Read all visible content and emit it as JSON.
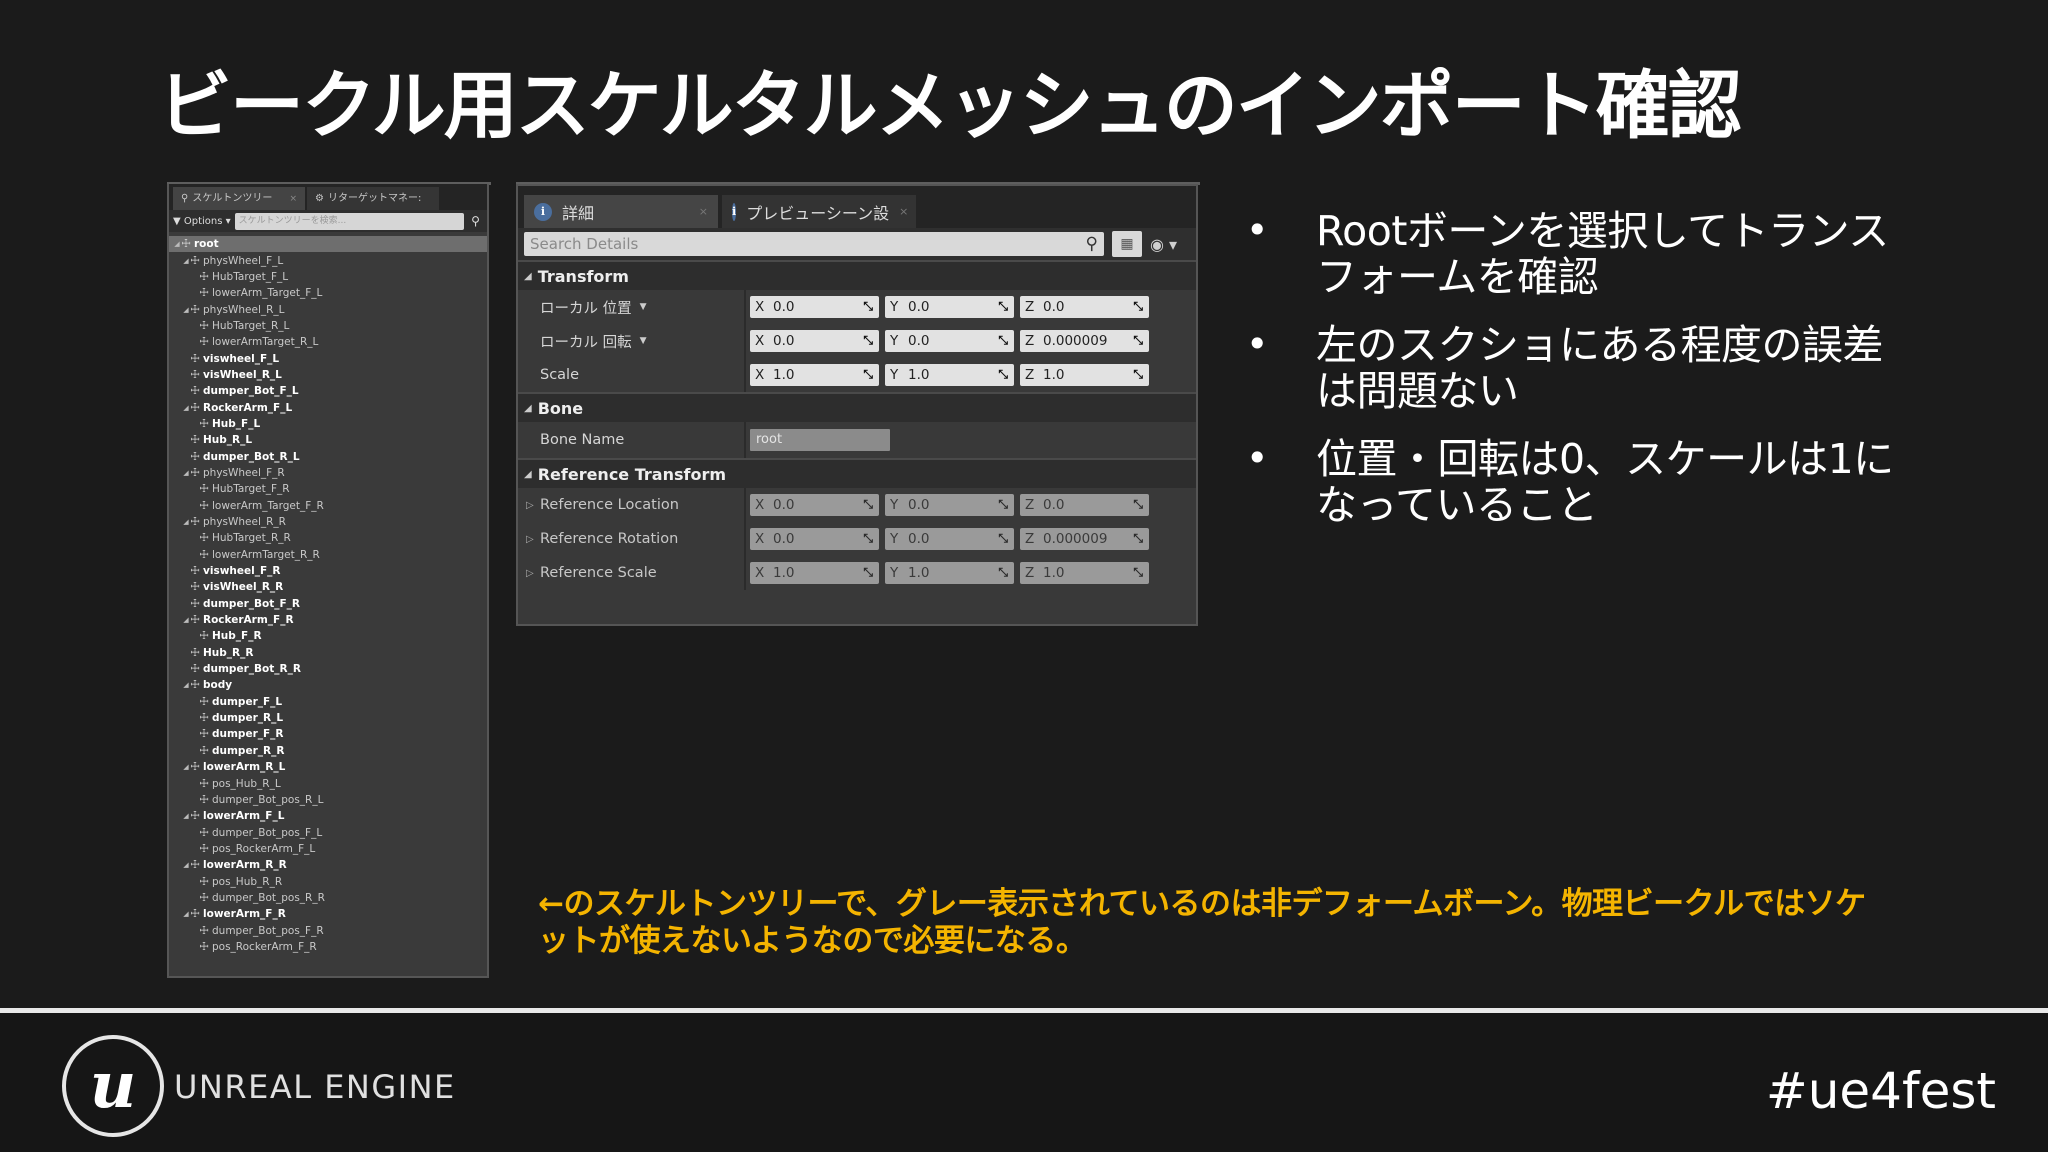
{
  "slide": {
    "title": "ビークル用スケルタルメッシュのインポート確認"
  },
  "skeleton_tree": {
    "tabs": [
      {
        "label": "スケルトンツリー",
        "icon": "skeleton-tree-icon"
      },
      {
        "label": "リターゲットマネー:",
        "icon": "retarget-manager-icon"
      }
    ],
    "options_label": "Options",
    "search_placeholder": "スケルトンツリーを検索...",
    "bones": [
      {
        "name": "root",
        "depth": 0,
        "expanded": true,
        "selected": true,
        "kind": "deform"
      },
      {
        "name": "physWheel_F_L",
        "depth": 1,
        "expanded": true,
        "kind": "nondeform"
      },
      {
        "name": "HubTarget_F_L",
        "depth": 2,
        "kind": "nondeform"
      },
      {
        "name": "lowerArm_Target_F_L",
        "depth": 2,
        "kind": "nondeform"
      },
      {
        "name": "physWheel_R_L",
        "depth": 1,
        "expanded": true,
        "kind": "nondeform"
      },
      {
        "name": "HubTarget_R_L",
        "depth": 2,
        "kind": "nondeform"
      },
      {
        "name": "lowerArmTarget_R_L",
        "depth": 2,
        "kind": "nondeform"
      },
      {
        "name": "viswheel_F_L",
        "depth": 1,
        "kind": "deform"
      },
      {
        "name": "visWheel_R_L",
        "depth": 1,
        "kind": "deform"
      },
      {
        "name": "dumper_Bot_F_L",
        "depth": 1,
        "kind": "deform"
      },
      {
        "name": "RockerArm_F_L",
        "depth": 1,
        "expanded": true,
        "kind": "deform"
      },
      {
        "name": "Hub_F_L",
        "depth": 2,
        "kind": "deform"
      },
      {
        "name": "Hub_R_L",
        "depth": 1,
        "kind": "deform"
      },
      {
        "name": "dumper_Bot_R_L",
        "depth": 1,
        "kind": "deform"
      },
      {
        "name": "physWheel_F_R",
        "depth": 1,
        "expanded": true,
        "kind": "nondeform"
      },
      {
        "name": "HubTarget_F_R",
        "depth": 2,
        "kind": "nondeform"
      },
      {
        "name": "lowerArm_Target_F_R",
        "depth": 2,
        "kind": "nondeform"
      },
      {
        "name": "physWheel_R_R",
        "depth": 1,
        "expanded": true,
        "kind": "nondeform"
      },
      {
        "name": "HubTarget_R_R",
        "depth": 2,
        "kind": "nondeform"
      },
      {
        "name": "lowerArmTarget_R_R",
        "depth": 2,
        "kind": "nondeform"
      },
      {
        "name": "viswheel_F_R",
        "depth": 1,
        "kind": "deform"
      },
      {
        "name": "visWheel_R_R",
        "depth": 1,
        "kind": "deform"
      },
      {
        "name": "dumper_Bot_F_R",
        "depth": 1,
        "kind": "deform"
      },
      {
        "name": "RockerArm_F_R",
        "depth": 1,
        "expanded": true,
        "kind": "deform"
      },
      {
        "name": "Hub_F_R",
        "depth": 2,
        "kind": "deform"
      },
      {
        "name": "Hub_R_R",
        "depth": 1,
        "kind": "deform"
      },
      {
        "name": "dumper_Bot_R_R",
        "depth": 1,
        "kind": "deform"
      },
      {
        "name": "body",
        "depth": 1,
        "expanded": true,
        "kind": "deform"
      },
      {
        "name": "dumper_F_L",
        "depth": 2,
        "kind": "deform"
      },
      {
        "name": "dumper_R_L",
        "depth": 2,
        "kind": "deform"
      },
      {
        "name": "dumper_F_R",
        "depth": 2,
        "kind": "deform"
      },
      {
        "name": "dumper_R_R",
        "depth": 2,
        "kind": "deform"
      },
      {
        "name": "lowerArm_R_L",
        "depth": 1,
        "expanded": true,
        "kind": "deform"
      },
      {
        "name": "pos_Hub_R_L",
        "depth": 2,
        "kind": "nondeform"
      },
      {
        "name": "dumper_Bot_pos_R_L",
        "depth": 2,
        "kind": "nondeform"
      },
      {
        "name": "lowerArm_F_L",
        "depth": 1,
        "expanded": true,
        "kind": "deform"
      },
      {
        "name": "dumper_Bot_pos_F_L",
        "depth": 2,
        "kind": "nondeform"
      },
      {
        "name": "pos_RockerArm_F_L",
        "depth": 2,
        "kind": "nondeform"
      },
      {
        "name": "lowerArm_R_R",
        "depth": 1,
        "expanded": true,
        "kind": "deform"
      },
      {
        "name": "pos_Hub_R_R",
        "depth": 2,
        "kind": "nondeform"
      },
      {
        "name": "dumper_Bot_pos_R_R",
        "depth": 2,
        "kind": "nondeform"
      },
      {
        "name": "lowerArm_F_R",
        "depth": 1,
        "expanded": true,
        "kind": "deform"
      },
      {
        "name": "dumper_Bot_pos_F_R",
        "depth": 2,
        "kind": "nondeform"
      },
      {
        "name": "pos_RockerArm_F_R",
        "depth": 2,
        "kind": "nondeform"
      }
    ]
  },
  "details": {
    "tabs": [
      {
        "label": "詳細",
        "icon": "info-icon"
      },
      {
        "label": "プレビューシーン設",
        "icon": "info-icon"
      }
    ],
    "search_placeholder": "Search Details",
    "transform": {
      "title": "Transform",
      "rows": [
        {
          "label": "ローカル 位置",
          "x": "0.0",
          "y": "0.0",
          "z": "0.0"
        },
        {
          "label": "ローカル 回転",
          "x": "0.0",
          "y": "0.0",
          "z": "0.000009"
        },
        {
          "label": "Scale",
          "x": "1.0",
          "y": "1.0",
          "z": "1.0"
        }
      ]
    },
    "bone": {
      "title": "Bone",
      "name_label": "Bone Name",
      "name_value": "root"
    },
    "reference_transform": {
      "title": "Reference Transform",
      "rows": [
        {
          "label": "Reference Location",
          "x": "0.0",
          "y": "0.0",
          "z": "0.0"
        },
        {
          "label": "Reference Rotation",
          "x": "0.0",
          "y": "0.0",
          "z": "0.000009"
        },
        {
          "label": "Reference Scale",
          "x": "1.0",
          "y": "1.0",
          "z": "1.0"
        }
      ]
    },
    "axis_labels": {
      "x": "X",
      "y": "Y",
      "z": "Z"
    }
  },
  "bullets": [
    "Rootボーンを選択してトランスフォームを確認",
    "左のスクショにある程度の誤差は問題ない",
    "位置・回転は0、スケールは1になっていること"
  ],
  "note": "←のスケルトンツリーで、グレー表示されているのは非デフォームボーン。物理ビークルではソケットが使えないようなので必要になる。",
  "footer": {
    "engine_name": "UNREAL ENGINE",
    "hashtag": "#ue4fest",
    "accent_color": "#f4b400"
  }
}
